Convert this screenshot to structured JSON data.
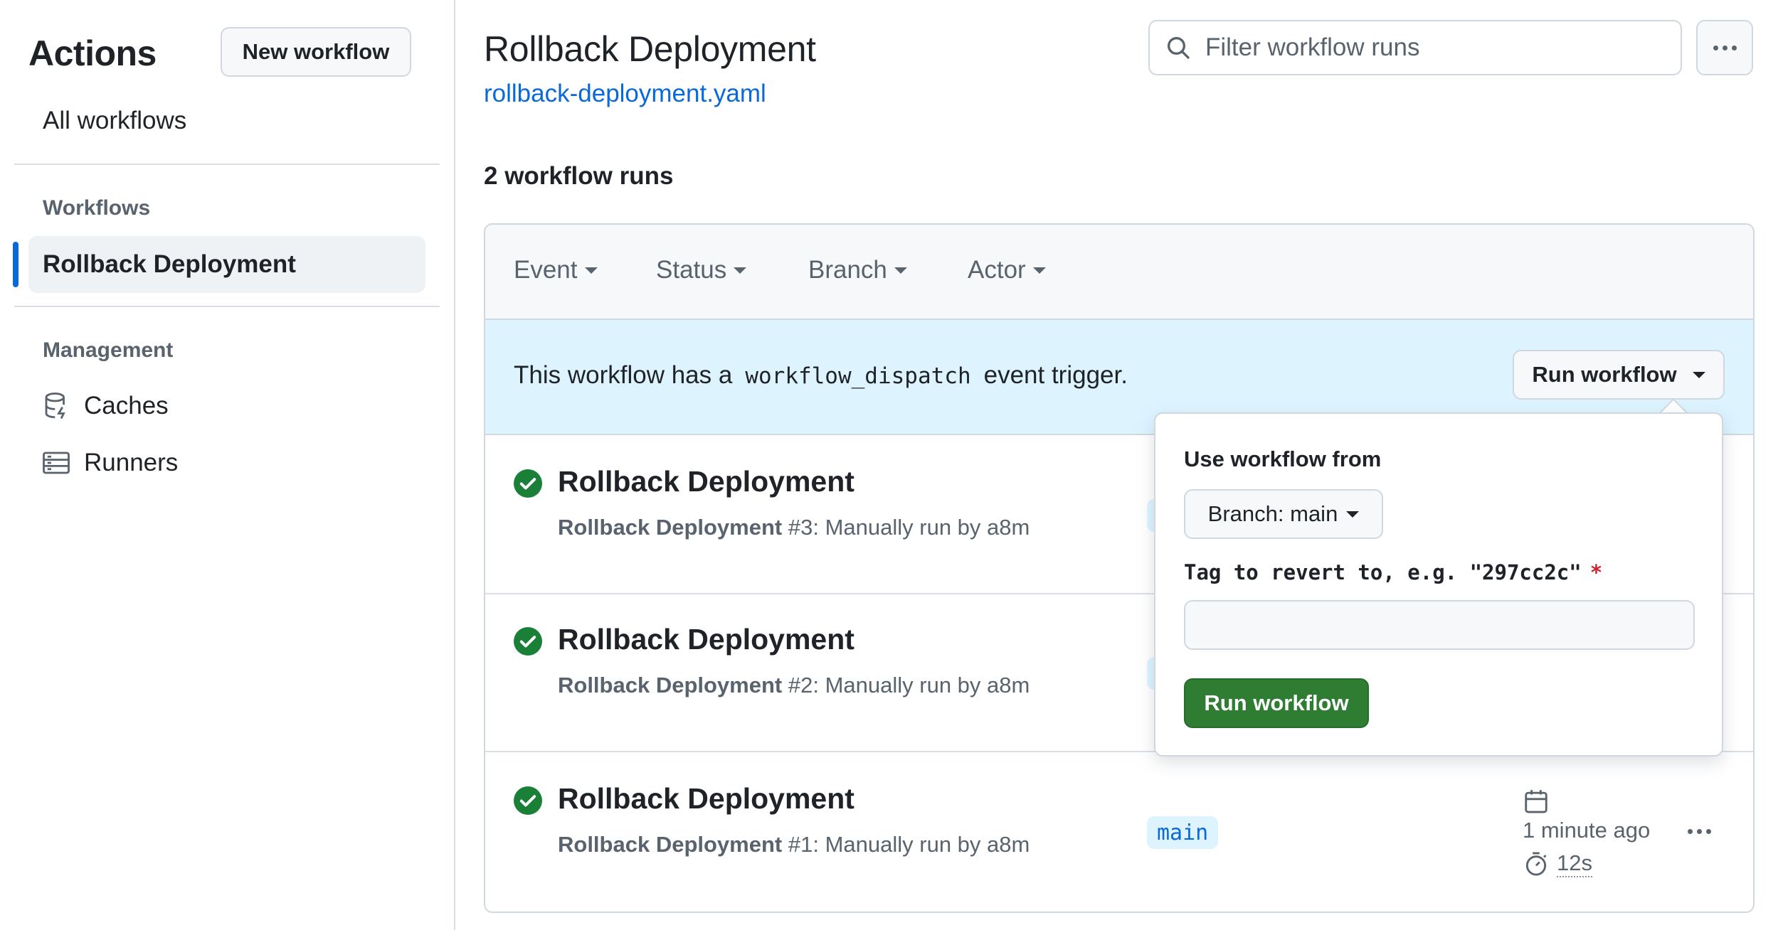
{
  "sidebar": {
    "title": "Actions",
    "new_workflow": "New workflow",
    "all_workflows": "All workflows",
    "workflows_heading": "Workflows",
    "active_workflow": "Rollback Deployment",
    "management_heading": "Management",
    "items": [
      {
        "label": "Caches",
        "icon": "database-icon"
      },
      {
        "label": "Runners",
        "icon": "server-icon"
      }
    ]
  },
  "header": {
    "title": "Rollback Deployment",
    "file": "rollback-deployment.yaml",
    "filter_placeholder": "Filter workflow runs"
  },
  "runs_count": "2 workflow runs",
  "filters": [
    "Event",
    "Status",
    "Branch",
    "Actor"
  ],
  "banner": {
    "prefix": "This workflow has a",
    "code": "workflow_dispatch",
    "suffix": "event trigger.",
    "run_button": "Run workflow"
  },
  "runs": [
    {
      "title": "Rollback Deployment",
      "name": "Rollback Deployment",
      "detail": "#3: Manually run by a8m"
    },
    {
      "title": "Rollback Deployment",
      "name": "Rollback Deployment",
      "detail": "#2: Manually run by a8m"
    },
    {
      "title": "Rollback Deployment",
      "name": "Rollback Deployment",
      "detail": "#1: Manually run by a8m",
      "branch": "main",
      "time": "1 minute ago",
      "duration": "12s"
    }
  ],
  "popover": {
    "label": "Use workflow from",
    "branch_button": "Branch: main",
    "input_label": "Tag to revert to, e.g. \"297cc2c\"",
    "required_mark": "*",
    "submit": "Run workflow"
  },
  "colors": {
    "accent": "#0969da",
    "success": "#1a7f37",
    "banner_bg": "#ddf4ff",
    "primary_button": "#2f7d32"
  }
}
